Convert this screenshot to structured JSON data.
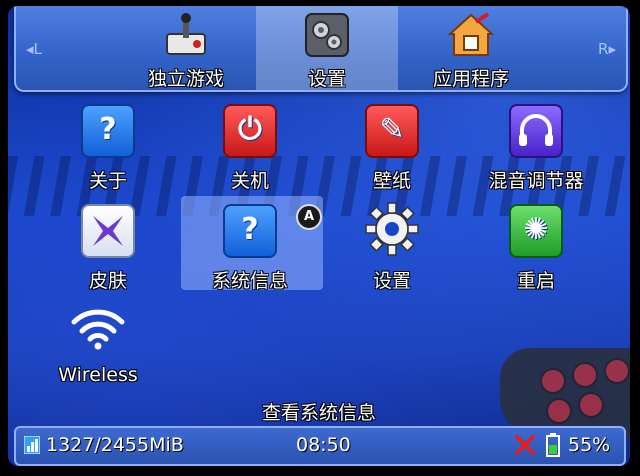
{
  "top_menu": {
    "left_hint": "◂L",
    "right_hint": "R▸",
    "tabs": [
      {
        "label": "独立游戏",
        "icon": "joystick-icon",
        "active": false
      },
      {
        "label": "设置",
        "icon": "settings-gears-icon",
        "active": true
      },
      {
        "label": "应用程序",
        "icon": "house-icon",
        "active": false
      }
    ]
  },
  "apps": [
    {
      "label": "关于",
      "icon": "question-icon",
      "glyph": "?"
    },
    {
      "label": "关机",
      "icon": "power-icon",
      "glyph": "⏻"
    },
    {
      "label": "壁纸",
      "icon": "wallpaper-icon",
      "glyph": "✎"
    },
    {
      "label": "混音调节器",
      "icon": "headphones-icon",
      "glyph": "🎧"
    },
    {
      "label": "皮肤",
      "icon": "skin-icon",
      "glyph": "✖"
    },
    {
      "label": "系统信息",
      "icon": "question-icon",
      "glyph": "?"
    },
    {
      "label": "设置",
      "icon": "gear-icon",
      "glyph": "⚙"
    },
    {
      "label": "重启",
      "icon": "restart-icon",
      "glyph": "✺"
    },
    {
      "label": "Wireless",
      "icon": "wifi-icon",
      "glyph": ""
    }
  ],
  "selected_badge": "A",
  "hint": "查看系统信息",
  "status": {
    "memory": "1327/2455MiB",
    "time": "08:50",
    "battery": "55%"
  }
}
